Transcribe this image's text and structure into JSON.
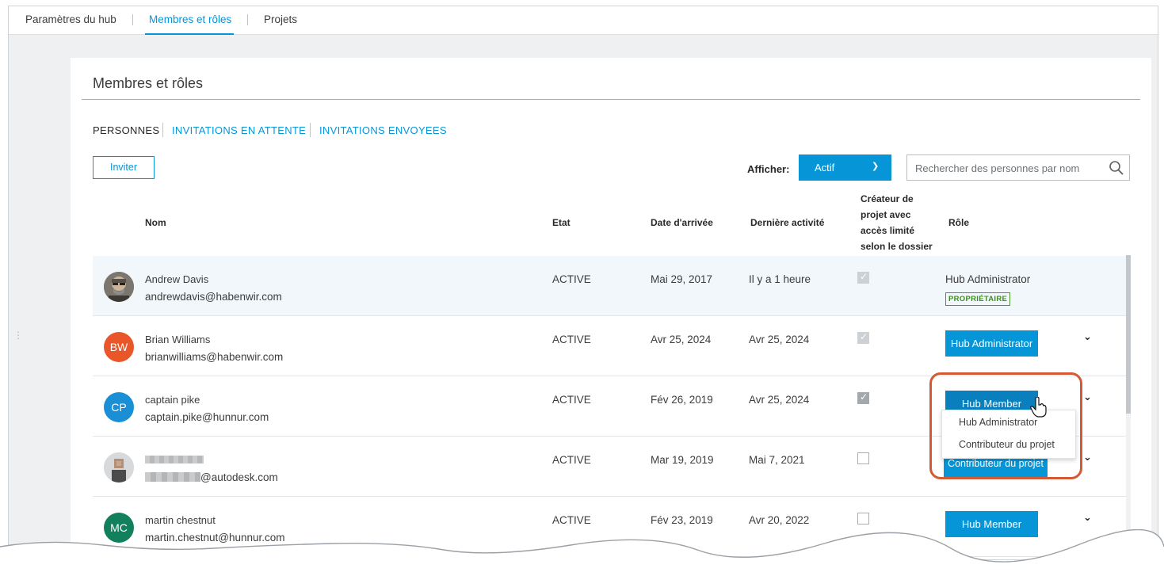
{
  "topnav": {
    "items": [
      "Paramètres du hub",
      "Membres et rôles",
      "Projets"
    ],
    "active": "Membres et rôles"
  },
  "card": {
    "title": "Membres et rôles",
    "subtabs": [
      "PERSONNES",
      "INVITATIONS EN ATTENTE",
      "INVITATIONS ENVOYEES"
    ],
    "invite_label": "Inviter",
    "filter_label": "Afficher:",
    "filter_value": "Actif",
    "search_placeholder": "Rechercher des personnes par nom"
  },
  "table": {
    "headers": {
      "name": "Nom",
      "status": "Etat",
      "joined": "Date d'arrivée",
      "last_activity": "Dernière activité",
      "creator": [
        "Créateur de",
        "projet avec",
        "accès limité",
        "selon le dossier"
      ],
      "role": "Rôle"
    },
    "rows": [
      {
        "initials": "",
        "name": "Andrew Davis",
        "email": "andrewdavis@habenwir.com",
        "status": "ACTIVE",
        "joined": "Mai 29, 2017",
        "last": "Il y a 1 heure",
        "role": "Hub Administrator",
        "badge": "PROPRIÉTAIRE"
      },
      {
        "initials": "BW",
        "name": "Brian Williams",
        "email": "brianwilliams@habenwir.com",
        "status": "ACTIVE",
        "joined": "Avr 25, 2024",
        "last": "Avr 25, 2024",
        "role": "Hub Administrator"
      },
      {
        "initials": "CP",
        "name": "captain pike",
        "email": "captain.pike@hunnur.com",
        "status": "ACTIVE",
        "joined": "Fév 26, 2019",
        "last": "Avr 25, 2024",
        "role": "Hub Member"
      },
      {
        "initials": "",
        "name": "",
        "email": "@autodesk.com",
        "status": "ACTIVE",
        "joined": "Mar 19, 2019",
        "last": "Mai 7, 2021",
        "role": "Contributeur du projet"
      },
      {
        "initials": "MC",
        "name": "martin chestnut",
        "email": "martin.chestnut@hunnur.com",
        "status": "ACTIVE",
        "joined": "Fév 23, 2019",
        "last": "Avr 20, 2022",
        "role": "Hub Member"
      }
    ]
  },
  "dropdown": {
    "options": [
      "Hub Administrator",
      "Contributeur du projet"
    ]
  },
  "colors": {
    "accent": "#0696d7",
    "bw_avatar": "#e8562a",
    "cp_avatar": "#1b8fd6",
    "mc_avatar": "#12805c",
    "highlight": "#d35a34",
    "owner_badge": "#3f8c22"
  },
  "icons": [
    "search-icon",
    "chevron-down-icon",
    "checkbox-icon",
    "hand-cursor-icon"
  ]
}
